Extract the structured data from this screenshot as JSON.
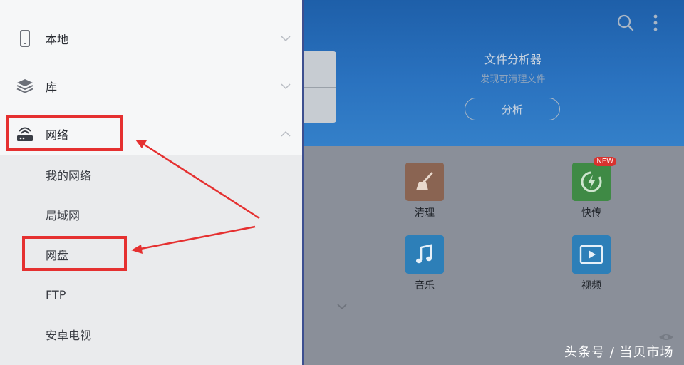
{
  "background_app": {
    "analyzer_title": "文件分析器",
    "analyzer_subtitle": "发现可清理文件",
    "analyze_button": "分析",
    "tiles": [
      {
        "label": "清理",
        "icon": "broom-icon",
        "color": "#8a6452"
      },
      {
        "label": "快传",
        "icon": "quick-transfer-icon",
        "color": "#3f8a45",
        "badge": "NEW"
      },
      {
        "label": "音乐",
        "icon": "music-note-icon",
        "color": "#2d7fb8"
      },
      {
        "label": "视频",
        "icon": "video-play-icon",
        "color": "#2d7fb8"
      }
    ]
  },
  "drawer": {
    "items": [
      {
        "label": "本地",
        "icon": "phone-icon",
        "expanded": false
      },
      {
        "label": "库",
        "icon": "layers-icon",
        "expanded": false
      },
      {
        "label": "网络",
        "icon": "router-icon",
        "expanded": true
      }
    ],
    "network_children": [
      "我的网络",
      "局域网",
      "网盘",
      "FTP",
      "安卓电视"
    ]
  },
  "watermark": "头条号 / 当贝市场",
  "colors": {
    "header_blue": "#2a72bf",
    "highlight_red": "#e53030",
    "drawer_bg": "#eaebed",
    "dim_bg": "#8a8f99"
  }
}
